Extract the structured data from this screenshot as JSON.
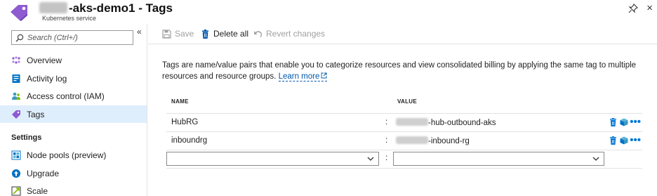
{
  "header": {
    "title_suffix": "-aks-demo1 - Tags",
    "subtitle": "Kubernetes service",
    "resource_icon": "tag-icon",
    "pin_icon": "pin-icon",
    "close_icon": "close-icon",
    "close_glyph": "×"
  },
  "sidebar": {
    "search_placeholder": "Search (Ctrl+/)",
    "collapse_glyph": "«",
    "items": [
      {
        "label": "Overview",
        "icon": "overview-icon"
      },
      {
        "label": "Activity log",
        "icon": "activity-log-icon"
      },
      {
        "label": "Access control (IAM)",
        "icon": "iam-icon"
      },
      {
        "label": "Tags",
        "icon": "tag-icon",
        "active": true
      }
    ],
    "section_settings": "Settings",
    "settings_items": [
      {
        "label": "Node pools (preview)",
        "icon": "node-pools-icon"
      },
      {
        "label": "Upgrade",
        "icon": "upgrade-icon"
      },
      {
        "label": "Scale",
        "icon": "scale-icon"
      }
    ]
  },
  "toolbar": {
    "save_label": "Save",
    "delete_all_label": "Delete all",
    "revert_label": "Revert changes"
  },
  "main": {
    "description": "Tags are name/value pairs that enable you to categorize resources and view consolidated billing by applying the same tag to multiple resources and resource groups.",
    "learn_more": "Learn more",
    "col_name": "NAME",
    "col_value": "VALUE",
    "separator": ":",
    "rows": [
      {
        "name": "HubRG",
        "value_suffix": "-hub-outbound-aks"
      },
      {
        "name": "inboundrg",
        "value_suffix": "-inbound-rg"
      }
    ],
    "new_name_value": "",
    "new_value_value": ""
  },
  "colors": {
    "accent": "#0078d4",
    "active_nav": "#dfeefc",
    "tag_purple": "#8e5bd1"
  }
}
